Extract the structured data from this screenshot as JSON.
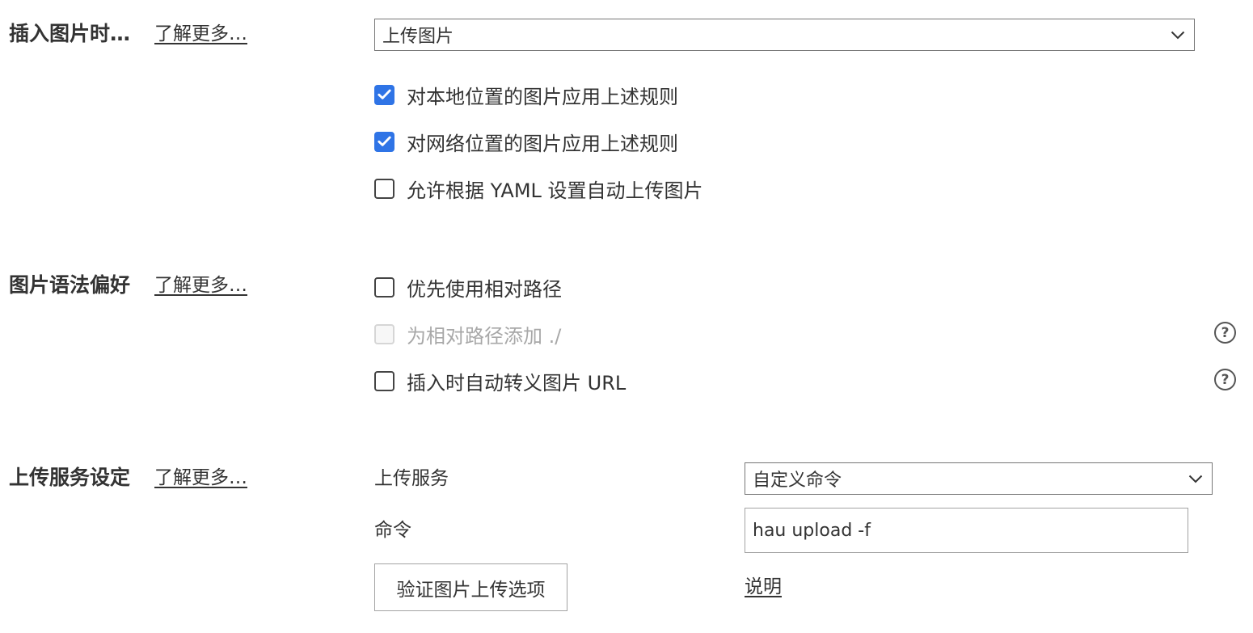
{
  "colors": {
    "accent": "#2f74e6",
    "text": "#333333",
    "disabled_text": "#a8a8a8",
    "border": "#767676"
  },
  "insert_image": {
    "title": "插入图片时…",
    "learn_more": "了解更多…",
    "select_value": "上传图片",
    "options": [
      {
        "label": "对本地位置的图片应用上述规则",
        "checked": true,
        "disabled": false
      },
      {
        "label": "对网络位置的图片应用上述规则",
        "checked": true,
        "disabled": false
      },
      {
        "label": "允许根据 YAML 设置自动上传图片",
        "checked": false,
        "disabled": false
      }
    ]
  },
  "image_syntax": {
    "title": "图片语法偏好",
    "learn_more": "了解更多…",
    "options": [
      {
        "label": "优先使用相对路径",
        "checked": false,
        "disabled": false,
        "help": false
      },
      {
        "label": "为相对路径添加 ./",
        "checked": false,
        "disabled": true,
        "help": true,
        "help_glyph": "?"
      },
      {
        "label": "插入时自动转义图片 URL",
        "checked": false,
        "disabled": false,
        "help": true,
        "help_glyph": "?"
      }
    ]
  },
  "upload_service": {
    "title": "上传服务设定",
    "learn_more": "了解更多…",
    "service_label": "上传服务",
    "service_value": "自定义命令",
    "command_label": "命令",
    "command_value": "hau upload -f",
    "verify_button": "验证图片上传选项",
    "help_link": "说明"
  },
  "icons": {
    "chevron": "chevron-down-icon",
    "check": "checkmark-icon",
    "help": "help-circle-icon"
  }
}
